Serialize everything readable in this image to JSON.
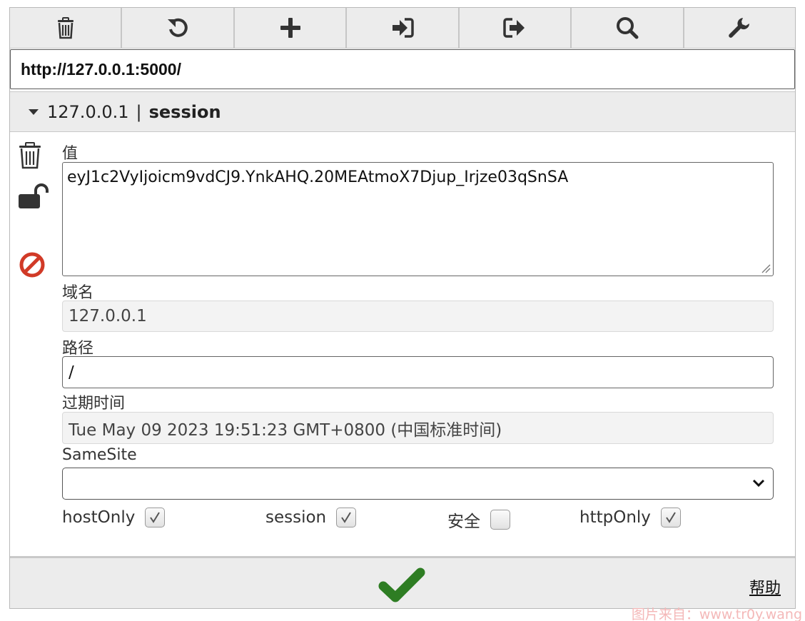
{
  "toolbar": {
    "tools": [
      {
        "icon": "trash-icon",
        "label": "delete all"
      },
      {
        "icon": "reset-icon",
        "label": "reset"
      },
      {
        "icon": "plus-icon",
        "label": "add"
      },
      {
        "icon": "import-icon",
        "label": "import"
      },
      {
        "icon": "export-icon",
        "label": "export"
      },
      {
        "icon": "search-icon",
        "label": "search"
      },
      {
        "icon": "wrench-icon",
        "label": "options"
      }
    ]
  },
  "url": "http://127.0.0.1:5000/",
  "cookie": {
    "domain_head": "127.0.0.1",
    "separator": "|",
    "name": "session"
  },
  "form": {
    "value_label": "值",
    "value": "eyJ1c2VyIjoicm9vdCJ9.YnkAHQ.20MEAtmoX7Djup_Irjze03qSnSA",
    "domain_label": "域名",
    "domain": "127.0.0.1",
    "path_label": "路径",
    "path": "/",
    "expires_label": "过期时间",
    "expires": "Tue May 09 2023 19:51:23 GMT+0800 (中国标准时间)",
    "samesite_label": "SameSite",
    "samesite_value": ""
  },
  "flags": {
    "hostonly_label": "hostOnly",
    "hostonly": true,
    "session_label": "session",
    "session": true,
    "secure_label": "安全",
    "secure": false,
    "httponly_label": "httpOnly",
    "httponly": true
  },
  "footer": {
    "help_label": "帮助"
  },
  "watermark": "图片来自：www.tr0y.wang",
  "colors": {
    "confirm_green": "#2e7d23",
    "block_red": "#d13a27"
  }
}
